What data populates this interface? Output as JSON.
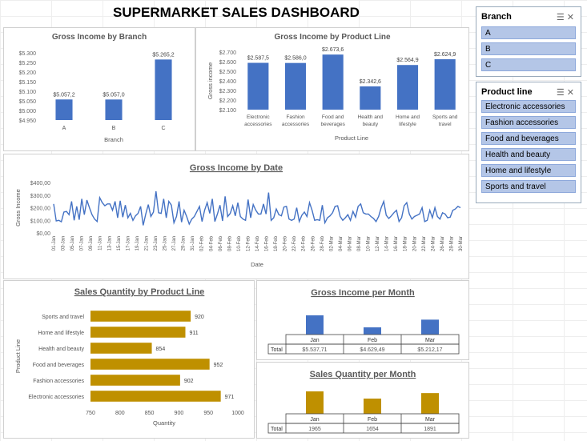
{
  "dashboard_title": "SUPERMARKET SALES DASHBOARD",
  "colors": {
    "blue": "#4472c4",
    "gold": "#bf9000",
    "line": "#4472c4"
  },
  "chart_data": [
    {
      "id": "branch",
      "type": "bar",
      "title": "Gross Income by Branch",
      "xlabel": "Branch",
      "ylabel": "",
      "categories": [
        "A",
        "B",
        "C"
      ],
      "values": [
        5057.2,
        5057.0,
        5265.2
      ],
      "value_labels": [
        "$5.057,2",
        "$5.057,0",
        "$5.265,2"
      ],
      "ylim": [
        4950,
        5300
      ],
      "yticks": [
        "$4.950",
        "$5.000",
        "$5.050",
        "$5.100",
        "$5.150",
        "$5.200",
        "$5.250",
        "$5.300"
      ]
    },
    {
      "id": "productline",
      "type": "bar",
      "title": "Gross Income by Product Line",
      "xlabel": "Product Line",
      "ylabel": "Gross income",
      "categories": [
        [
          "Electronic",
          "accessories"
        ],
        [
          "Fashion",
          "accessories"
        ],
        [
          "Food and",
          "beverages"
        ],
        [
          "Health and",
          "beauty"
        ],
        [
          "Home and",
          "lifestyle"
        ],
        [
          "Sports and",
          "travel"
        ]
      ],
      "values": [
        2587.5,
        2586.0,
        2673.6,
        2342.6,
        2564.9,
        2624.9
      ],
      "value_labels": [
        "$2.587,5",
        "$2.586,0",
        "$2.673,6",
        "$2.342,6",
        "$2.564,9",
        "$2.624,9"
      ],
      "ylim": [
        2100,
        2700
      ],
      "yticks": [
        "$2.100",
        "$2.200",
        "$2.300",
        "$2.400",
        "$2.500",
        "$2.600",
        "$2.700"
      ]
    },
    {
      "id": "date",
      "type": "line",
      "title": "Gross Income by Date",
      "xlabel": "Date",
      "ylabel": "Gross Income",
      "ylim": [
        0,
        400
      ],
      "yticks": [
        "$0,00",
        "$100,00",
        "$200,00",
        "$300,00",
        "$400,00"
      ],
      "x": [
        "01-Jan",
        "03-Jan",
        "05-Jan",
        "07-Jan",
        "09-Jan",
        "11-Jan",
        "13-Jan",
        "15-Jan",
        "17-Jan",
        "19-Jan",
        "21-Jan",
        "23-Jan",
        "25-Jan",
        "27-Jan",
        "29-Jan",
        "31-Jan",
        "02-Feb",
        "04-Feb",
        "06-Feb",
        "08-Feb",
        "10-Feb",
        "12-Feb",
        "14-Feb",
        "16-Feb",
        "18-Feb",
        "20-Feb",
        "22-Feb",
        "24-Feb",
        "26-Feb",
        "28-Feb",
        "02-Mar",
        "04-Mar",
        "06-Mar",
        "08-Mar",
        "10-Mar",
        "12-Mar",
        "14-Mar",
        "16-Mar",
        "18-Mar",
        "20-Mar",
        "22-Mar",
        "24-Mar",
        "26-Mar",
        "28-Mar",
        "30-Mar"
      ],
      "values": [
        230,
        95,
        100,
        88,
        165,
        170,
        145,
        250,
        100,
        210,
        105,
        270,
        145,
        260,
        200,
        145,
        110,
        90,
        280,
        240,
        215,
        230,
        230,
        180,
        250,
        120,
        255,
        125,
        220,
        120,
        155,
        100,
        135,
        155,
        210,
        60,
        150,
        225,
        130,
        165,
        330,
        160,
        155,
        270,
        120,
        250,
        220,
        80,
        130,
        250,
        85,
        180,
        130,
        70,
        110,
        130,
        170,
        210,
        90,
        180,
        240,
        155,
        270,
        90,
        150,
        220,
        95,
        290,
        130,
        155,
        215,
        135,
        240,
        130,
        110,
        100,
        265,
        120,
        225,
        180,
        150,
        150,
        230,
        150,
        320,
        100,
        120,
        190,
        145,
        135,
        205,
        210,
        110,
        100,
        110,
        200,
        90,
        140,
        165,
        130,
        240,
        180,
        100,
        105,
        100,
        220,
        80,
        120,
        135,
        160,
        210,
        215,
        130,
        100,
        120,
        145,
        100,
        170,
        125,
        210,
        230,
        160,
        150,
        150,
        130,
        115,
        90,
        130,
        200,
        250,
        140,
        115,
        135,
        160,
        180,
        90,
        120,
        215,
        240,
        150,
        110,
        130,
        140,
        150,
        200,
        90,
        100,
        180,
        120,
        200,
        130,
        110,
        160,
        150,
        120,
        125,
        180,
        190,
        210,
        200
      ]
    },
    {
      "id": "qty_productline",
      "type": "bar",
      "orientation": "horizontal",
      "title": "Sales Quantity by Product Line",
      "xlabel": "Quantity",
      "ylabel": "Product Line",
      "categories": [
        "Sports and travel",
        "Home and lifestyle",
        "Health and beauty",
        "Food and beverages",
        "Fashion accessories",
        "Electronic accessories"
      ],
      "values": [
        920,
        911,
        854,
        952,
        902,
        971
      ],
      "xlim": [
        750,
        1000
      ],
      "xticks": [
        "750",
        "800",
        "850",
        "900",
        "950",
        "1000"
      ]
    },
    {
      "id": "income_month",
      "type": "bar",
      "title": "Gross Income per Month",
      "categories": [
        "Jan",
        "Feb",
        "Mar"
      ],
      "values": [
        5537.71,
        4629.49,
        5212.17
      ],
      "row_label": "Total",
      "value_labels": [
        "$5.537,71",
        "$4.629,49",
        "$5.212,17"
      ]
    },
    {
      "id": "qty_month",
      "type": "bar",
      "title": "Sales Quantity per Month",
      "categories": [
        "Jan",
        "Feb",
        "Mar"
      ],
      "values": [
        1965,
        1654,
        1891
      ],
      "row_label": "Total",
      "value_labels": [
        "1965",
        "1654",
        "1891"
      ]
    }
  ],
  "slicers": {
    "branch": {
      "title": "Branch",
      "items": [
        "A",
        "B",
        "C"
      ]
    },
    "product_line": {
      "title": "Product line",
      "items": [
        "Electronic accessories",
        "Fashion accessories",
        "Food and beverages",
        "Health and beauty",
        "Home and lifestyle",
        "Sports and travel"
      ]
    }
  }
}
